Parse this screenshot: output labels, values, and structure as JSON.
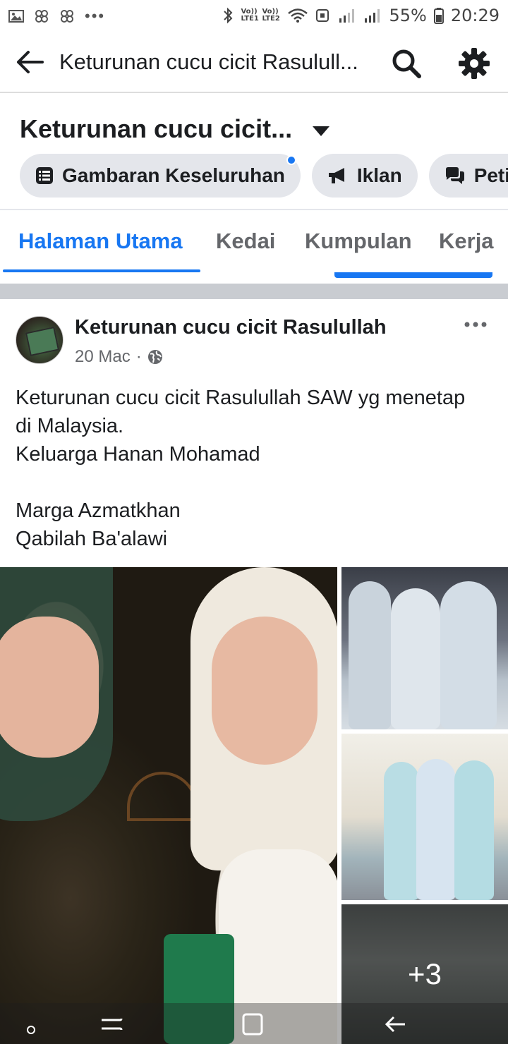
{
  "status_bar": {
    "battery": "55%",
    "time": "20:29",
    "volte1": "Vo)) LTE1",
    "volte2": "Vo)) LTE2"
  },
  "app_bar": {
    "title": "Keturunan cucu cicit Rasulull..."
  },
  "page_header": {
    "name": "Keturunan cucu cicit...",
    "chips": [
      {
        "label": "Gambaran Keseluruhan",
        "icon": "list-icon",
        "has_dot": true
      },
      {
        "label": "Iklan",
        "icon": "megaphone-icon"
      },
      {
        "label": "Peti M",
        "icon": "chat-icon"
      }
    ]
  },
  "tabs": [
    {
      "label": "Halaman Utama",
      "active": true
    },
    {
      "label": "Kedai"
    },
    {
      "label": "Kumpulan"
    },
    {
      "label": "Kerja"
    }
  ],
  "post": {
    "author": "Keturunan cucu cicit Rasulullah",
    "date": "20 Mac",
    "privacy": "·",
    "lines": [
      "Keturunan cucu cicit Rasulullah SAW yg menetap",
      "di Malaysia.",
      "Keluarga Hanan Mohamad",
      "",
      "Marga Azmatkhan",
      "Qabilah Ba'alawi"
    ],
    "more_photos": "+3"
  },
  "colors": {
    "accent": "#1877f2",
    "chip_bg": "#e4e6eb",
    "secondary_text": "#65676b"
  }
}
